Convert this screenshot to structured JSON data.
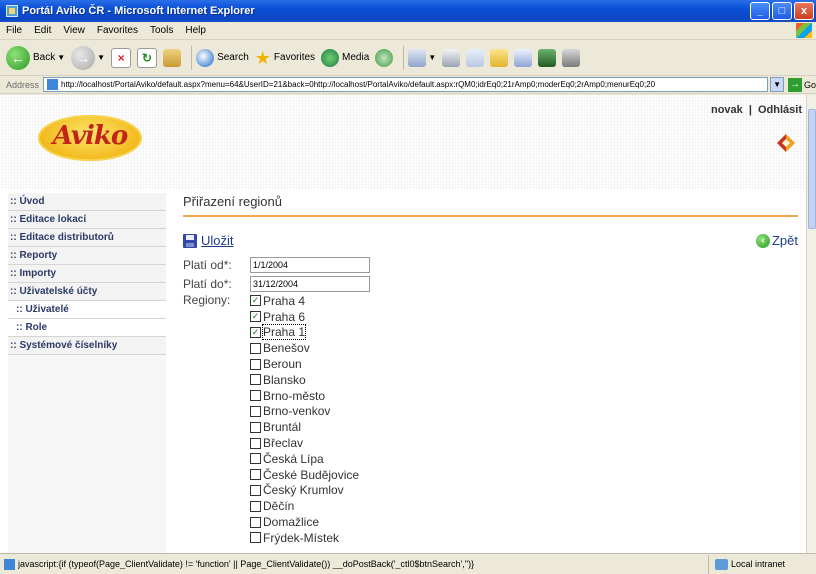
{
  "window": {
    "title": "Portál Aviko ČR - Microsoft Internet Explorer",
    "minimize": "_",
    "maximize": "□",
    "close": "x"
  },
  "menubar": [
    "File",
    "Edit",
    "View",
    "Favorites",
    "Tools",
    "Help"
  ],
  "toolbar": {
    "back": "Back",
    "search": "Search",
    "favorites": "Favorites",
    "media": "Media"
  },
  "address": {
    "label": "Address",
    "url": "http://localhost/PortalAviko/default.aspx?menu=64&UserID=21&back=0http://localhost/PortalAviko/default.aspx:rQM0;idrEq0;21rAmp0;moderEq0;2rAmp0;menurEq0;20",
    "go": "Go"
  },
  "header": {
    "logo_text": "Aviko",
    "user": "novak",
    "separator": "|",
    "logout": "Odhlásit"
  },
  "sidebar": {
    "items": [
      {
        "label": ":: Úvod"
      },
      {
        "label": ":: Editace lokací"
      },
      {
        "label": ":: Editace distributorů"
      },
      {
        "label": ":: Reporty"
      },
      {
        "label": ":: Importy"
      },
      {
        "label": ":: Uživatelské účty"
      },
      {
        "label": ":: Uživatelé"
      },
      {
        "label": ":: Role"
      },
      {
        "label": ":: Systémové číselníky"
      }
    ]
  },
  "main": {
    "title": "Přiřazení regionů",
    "save": "Uložit",
    "back": "Zpět",
    "valid_from_label": "Platí od*:",
    "valid_from_value": "1/1/2004",
    "valid_to_label": "Platí do*:",
    "valid_to_value": "31/12/2004",
    "regions_label": "Regiony:",
    "regions": [
      {
        "name": "Praha 4",
        "checked": true
      },
      {
        "name": "Praha 6",
        "checked": true
      },
      {
        "name": "Praha 1",
        "checked": true
      },
      {
        "name": "Benešov",
        "checked": false
      },
      {
        "name": "Beroun",
        "checked": false
      },
      {
        "name": "Blansko",
        "checked": false
      },
      {
        "name": "Brno-město",
        "checked": false
      },
      {
        "name": "Brno-venkov",
        "checked": false
      },
      {
        "name": "Bruntál",
        "checked": false
      },
      {
        "name": "Břeclav",
        "checked": false
      },
      {
        "name": "Česká Lípa",
        "checked": false
      },
      {
        "name": "České Budějovice",
        "checked": false
      },
      {
        "name": "Český Krumlov",
        "checked": false
      },
      {
        "name": "Děčín",
        "checked": false
      },
      {
        "name": "Domažlice",
        "checked": false
      },
      {
        "name": "Frýdek-Místek",
        "checked": false
      }
    ]
  },
  "statusbar": {
    "text": "javascript:{if (typeof(Page_ClientValidate) != 'function' || Page_ClientValidate()) __doPostBack('_ctl0$btnSearch','')}",
    "zone": "Local intranet"
  }
}
